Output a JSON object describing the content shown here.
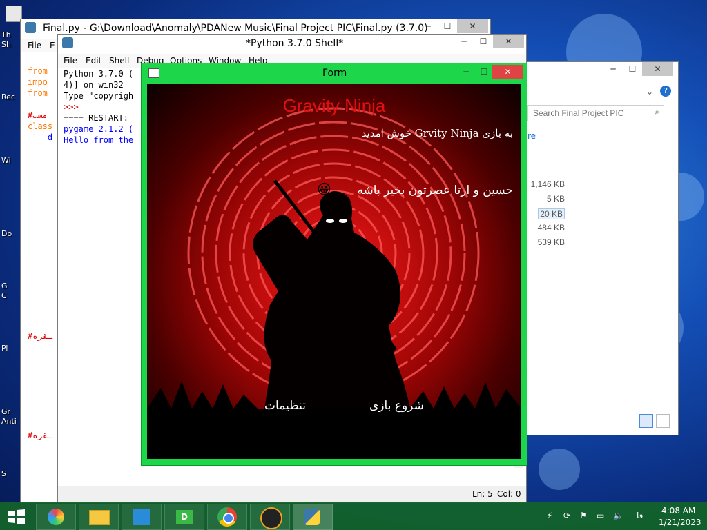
{
  "desktop": {
    "labels": [
      "Th",
      "Sh",
      "Rec",
      "Wi",
      "Do",
      "G",
      "C",
      "Pi",
      "Gr",
      "Anti",
      "S"
    ],
    "red_labels": [
      "#ـقره",
      "#ـقره"
    ]
  },
  "explorer": {
    "search_placeholder": "Search Final Project PIC",
    "partial_text": "re",
    "sizes": [
      "1,146 KB",
      "5 KB",
      "20 KB",
      "484 KB",
      "539 KB"
    ]
  },
  "editor": {
    "title": "Final.py - G:\\Download\\Anomaly\\PDANew Music\\Final Project PIC\\Final.py (3.7.0)",
    "menu": [
      "File",
      "E"
    ],
    "code": [
      "from",
      "impo",
      "from",
      "",
      "#مست",
      "class",
      "    d"
    ]
  },
  "shell": {
    "title": "*Python 3.7.0 Shell*",
    "menu": [
      "File",
      "Edit",
      "Shell",
      "Debug",
      "Options",
      "Window",
      "Help"
    ],
    "lines": [
      {
        "text": "Python 3.7.0 (",
        "color": "#000000"
      },
      {
        "text": "4)] on win32",
        "color": "#000000"
      },
      {
        "text": "Type \"copyrigh",
        "color": "#000000"
      },
      {
        "text": ">>>",
        "color": "#c00000"
      },
      {
        "text": "==== RESTART: ",
        "color": "#000000"
      },
      {
        "text": "pygame 2.1.2 (",
        "color": "#0000ff"
      },
      {
        "text": "Hello from the",
        "color": "#0000ff"
      }
    ],
    "status": {
      "ln": "Ln: 5",
      "col": "Col: 0"
    }
  },
  "form": {
    "title": "Form",
    "game_title": "Gravity Ninja",
    "welcome": "به بازی Grvity Ninja خوش امدید",
    "dedication": "حسین  و ارتا عصرتون بخیر باشه",
    "emoji": "😀",
    "start_button": "شروع بازی",
    "settings_button": "تنظیمات"
  },
  "taskbar": {
    "apps": [
      "windows-start",
      "paint-app",
      "file-explorer",
      "remote-app",
      "d-app",
      "chrome",
      "gom-app",
      "python-idle"
    ],
    "lang": "فا",
    "time": "4:08 AM",
    "date": "1/21/2023"
  },
  "colors": {
    "form_border": "#1ed64a",
    "taskbar": "#146428",
    "game_title": "#e01010"
  }
}
